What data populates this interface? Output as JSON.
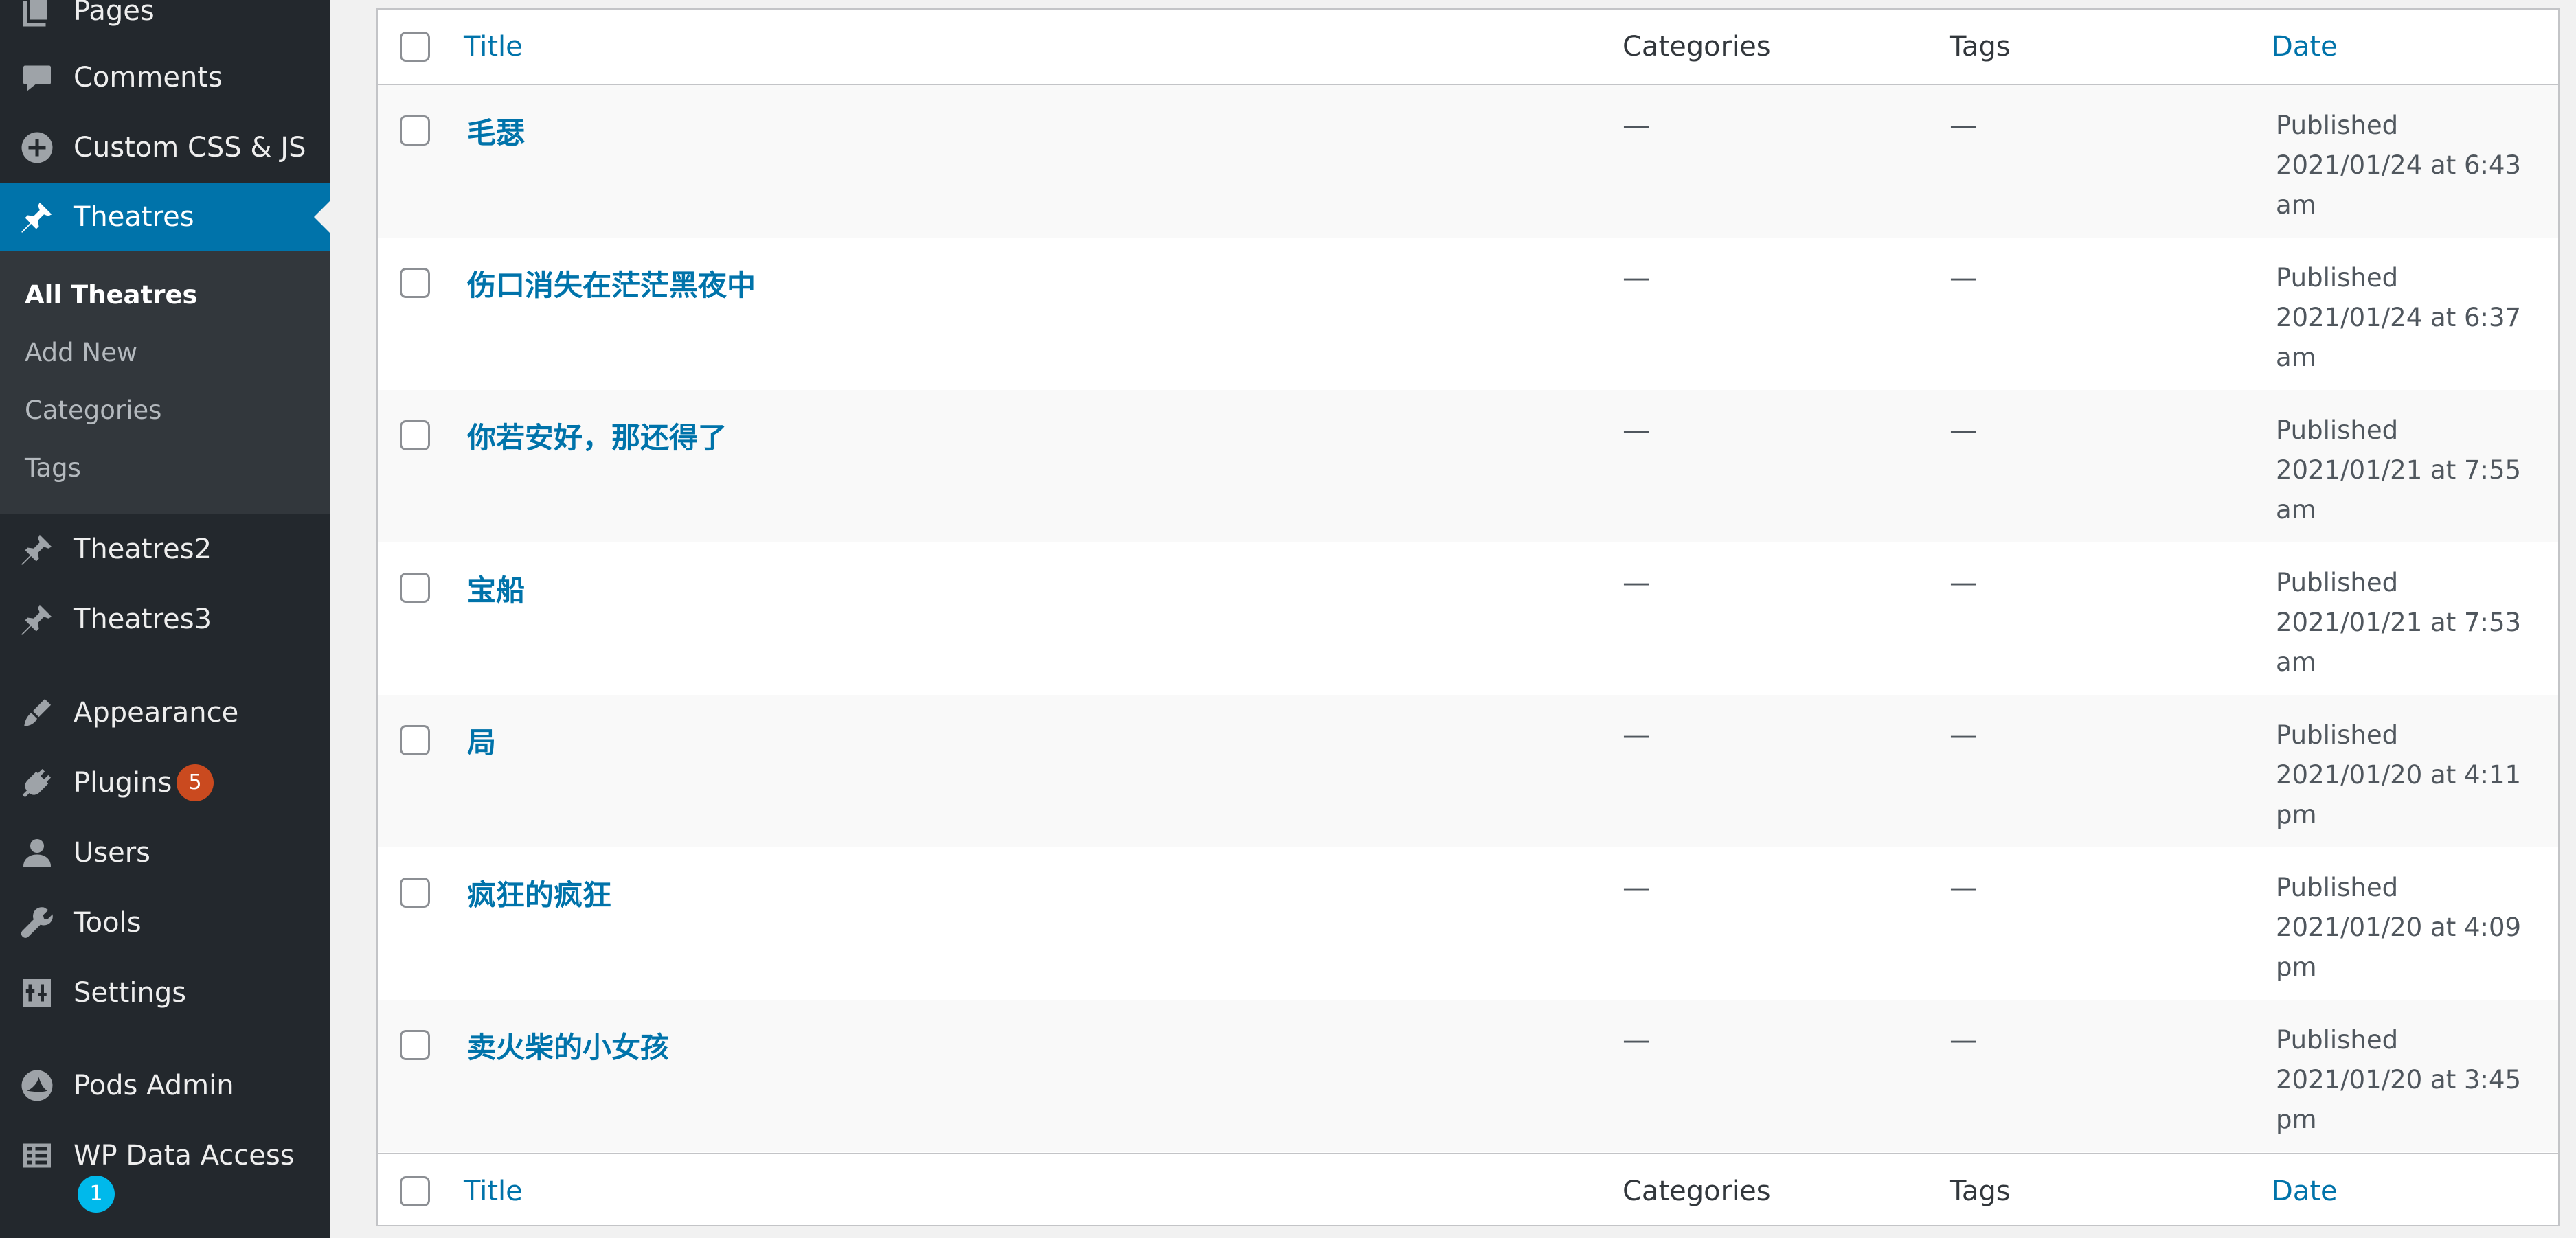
{
  "sidebar": {
    "items": [
      {
        "label": "Pages",
        "icon": "pages-icon"
      },
      {
        "label": "Comments",
        "icon": "comments-icon"
      },
      {
        "label": "Custom CSS & JS",
        "icon": "plus-circle-icon"
      },
      {
        "label": "Theatres",
        "icon": "pin-icon",
        "active": true
      },
      {
        "label": "Theatres2",
        "icon": "pin-icon"
      },
      {
        "label": "Theatres3",
        "icon": "pin-icon"
      },
      {
        "label": "Appearance",
        "icon": "brush-icon"
      },
      {
        "label": "Plugins",
        "icon": "plug-icon",
        "badge": "5"
      },
      {
        "label": "Users",
        "icon": "user-icon"
      },
      {
        "label": "Tools",
        "icon": "wrench-icon"
      },
      {
        "label": "Settings",
        "icon": "settings-icon"
      },
      {
        "label": "Pods Admin",
        "icon": "pods-icon"
      },
      {
        "label": "WP Data Access",
        "icon": "table-icon",
        "badge": "1"
      }
    ],
    "submenu": [
      {
        "label": "All Theatres",
        "current": true
      },
      {
        "label": "Add New"
      },
      {
        "label": "Categories"
      },
      {
        "label": "Tags"
      }
    ]
  },
  "table": {
    "columns": {
      "title": "Title",
      "categories": "Categories",
      "tags": "Tags",
      "date": "Date"
    },
    "rows": [
      {
        "title": "毛瑟",
        "categories": "—",
        "tags": "—",
        "status": "Published",
        "date": "2021/01/24 at 6:43",
        "ampm": "am"
      },
      {
        "title": "伤口消失在茫茫黑夜中",
        "categories": "—",
        "tags": "—",
        "status": "Published",
        "date": "2021/01/24 at 6:37",
        "ampm": "am"
      },
      {
        "title": "你若安好，那还得了",
        "categories": "—",
        "tags": "—",
        "status": "Published",
        "date": "2021/01/21 at 7:55",
        "ampm": "am"
      },
      {
        "title": "宝船",
        "categories": "—",
        "tags": "—",
        "status": "Published",
        "date": "2021/01/21 at 7:53",
        "ampm": "am"
      },
      {
        "title": "局",
        "categories": "—",
        "tags": "—",
        "status": "Published",
        "date": "2021/01/20 at 4:11",
        "ampm": "pm"
      },
      {
        "title": "疯狂的疯狂",
        "categories": "—",
        "tags": "—",
        "status": "Published",
        "date": "2021/01/20 at 4:09",
        "ampm": "pm"
      },
      {
        "title": "卖火柴的小女孩",
        "categories": "—",
        "tags": "—",
        "status": "Published",
        "date": "2021/01/20 at 3:45",
        "ampm": "pm"
      }
    ]
  },
  "colors": {
    "sidebar_bg": "#23282d",
    "submenu_bg": "#32373c",
    "active_bg": "#0073aa",
    "link": "#0073aa",
    "badge_orange": "#ca4a1f",
    "badge_blue": "#00b9eb"
  }
}
